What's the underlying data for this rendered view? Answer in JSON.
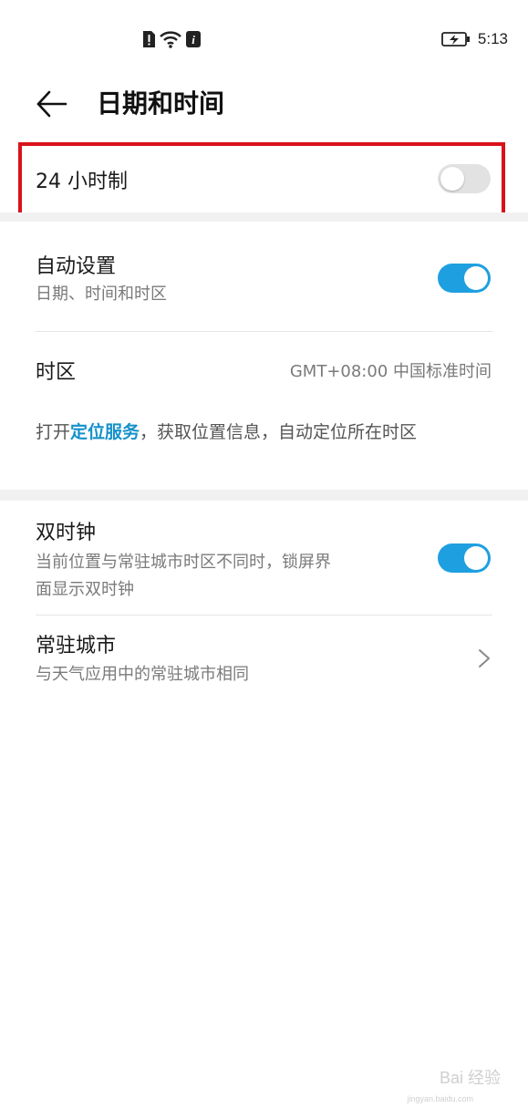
{
  "status_bar": {
    "time": "5:13",
    "left_icons": [
      "alert-sim-icon",
      "wifi-icon",
      "info-icon"
    ],
    "right_icons": [
      "battery-charging-icon"
    ]
  },
  "header": {
    "title": "日期和时间",
    "back_icon": "arrow-left-icon"
  },
  "settings": {
    "hour24": {
      "label": "24 小时制",
      "enabled": false
    },
    "auto_set": {
      "label": "自动设置",
      "subtitle": "日期、时间和时区",
      "enabled": true
    },
    "timezone": {
      "label": "时区",
      "value": "GMT+08:00 中国标准时间"
    },
    "location_note": {
      "prefix": "打开",
      "link": "定位服务",
      "suffix": "，获取位置信息，自动定位所在时区"
    },
    "dual_clock": {
      "label": "双时钟",
      "subtitle_line1": "当前位置与常驻城市时区不同时，锁屏界",
      "subtitle_line2": "面显示双时钟",
      "enabled": true
    },
    "home_city": {
      "label": "常驻城市",
      "subtitle": "与天气应用中的常驻城市相同"
    }
  },
  "colors": {
    "accent": "#1e9fe0",
    "link": "#1591c9",
    "highlight_box": "#d9121a",
    "toggle_off": "#e2e2e2"
  },
  "watermark": {
    "main": "Bai 经验",
    "sub": "jingyan.baidu.com"
  }
}
